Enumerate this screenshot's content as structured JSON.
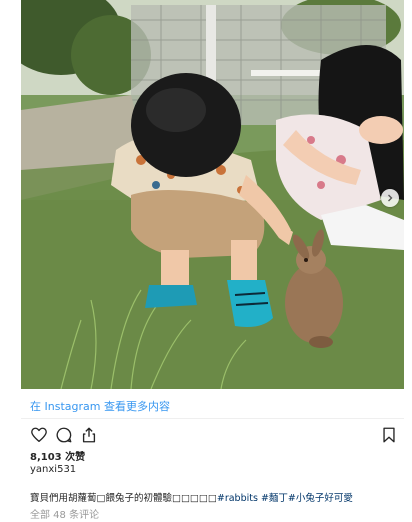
{
  "post": {
    "view_more": "在 Instagram 查看更多内容",
    "likes": "8,103 次赞",
    "username": "yanxi531",
    "caption_text": "寶貝們用胡蘿蔔□餵兔子的初體驗□□□□□",
    "caption_tags": [
      "#rabbits",
      "#麵丁",
      "#小兔子好可愛"
    ],
    "comments": "全部 48 条评论"
  },
  "icons": {
    "like": "heart-icon",
    "comment": "comment-bubble-icon",
    "share": "share-icon",
    "save": "bookmark-icon",
    "next": "chevron-right-icon"
  },
  "colors": {
    "link": "#3897f0",
    "hashtag": "#003569",
    "muted": "#999999",
    "text": "#262626"
  }
}
